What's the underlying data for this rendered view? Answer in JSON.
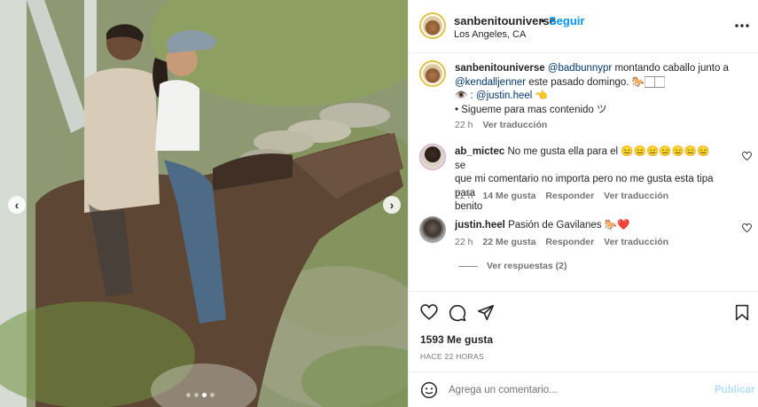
{
  "post": {
    "username": "sanbenitouniverse",
    "separator": "•",
    "follow_label": "Seguir",
    "location": "Los Angeles, CA",
    "more_label": "•••",
    "media_dots": 4,
    "media_active_dot": 3
  },
  "caption": {
    "username": "sanbenitouniverse",
    "mention1": "@badbunnypr",
    "text1": " montando caballo junto a",
    "mention2": "@kendalljenner",
    "text2": " este pasado domingo. 🐎🏻🏻",
    "eye": "👁️ : ",
    "mention3": "@justin.heel",
    "hand": " 👈",
    "line4": "• Sigueme para mas contenido ツ",
    "time": "22 h",
    "translate": "Ver traducción"
  },
  "comments": [
    {
      "username": "ab_mictec",
      "text_line1": " No me gusta ella para el 😑😑😑😑😑😑😑 se",
      "text_line2": "que mi comentario no importa pero no me gusta esta tipa para",
      "text_line3": "benito",
      "time": "22 h",
      "likes": "14 Me gusta",
      "reply": "Responder",
      "translate": "Ver traducción"
    },
    {
      "username": "justin.heel",
      "text": " Pasión de Gavilanes 🐎❤️",
      "time": "22 h",
      "likes": "22 Me gusta",
      "reply": "Responder",
      "translate": "Ver traducción",
      "view_replies": "Ver respuestas (2)"
    }
  ],
  "engagement": {
    "likes": "1593 Me gusta",
    "time_ago": "HACE 22 HORAS"
  },
  "composer": {
    "placeholder": "Agrega un comentario...",
    "publish": "Publicar"
  },
  "colors": {
    "link_blue": "#0095f6",
    "mention_blue": "#00376b",
    "publish_disabled": "#b2dffc",
    "like_red": "#ed4956"
  }
}
